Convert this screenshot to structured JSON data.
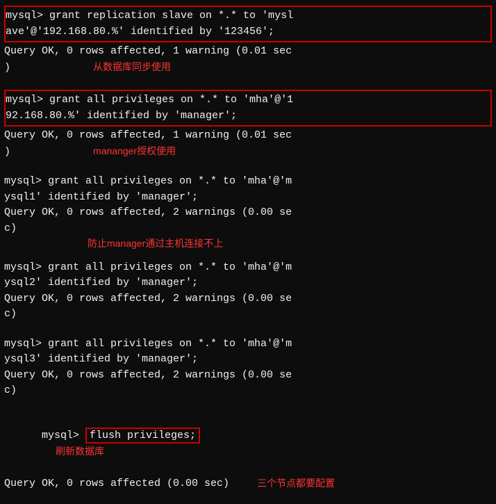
{
  "terminal": {
    "blocks": [
      {
        "id": "block1",
        "highlighted": true,
        "commands": [
          "mysql> grant replication slave on *.* to 'mysl",
          "ave'@'192.168.80.%' identified by '123456';"
        ],
        "results": [
          "Query OK, 0 rows affected, 1 warning (0.01 sec",
          ")"
        ],
        "annotation": "从数据库同步使用",
        "annotation_position": "inline"
      },
      {
        "id": "block2",
        "highlighted": true,
        "commands": [
          "mysql> grant all privileges on *.* to 'mha'@'1",
          "92.168.80.%' identified by 'manager';"
        ],
        "results": [
          "Query OK, 0 rows affected, 1 warning (0.01 sec",
          ")"
        ],
        "annotation": "mananger授权使用",
        "annotation_position": "inline"
      },
      {
        "id": "block3",
        "highlighted": false,
        "commands": [
          "mysql> grant all privileges on *.* to 'mha'@'m",
          "ysql1' identified by 'manager';"
        ],
        "results": [
          "Query OK, 0 rows affected, 2 warnings (0.00 se",
          "c)"
        ],
        "annotation": "防止manager通过主机连接不上",
        "annotation_position": "below"
      },
      {
        "id": "block4",
        "highlighted": false,
        "commands": [
          "mysql> grant all privileges on *.* to 'mha'@'m",
          "ysql2' identified by 'manager';"
        ],
        "results": [
          "Query OK, 0 rows affected, 2 warnings (0.00 se",
          "c)"
        ],
        "annotation": "",
        "annotation_position": ""
      },
      {
        "id": "block5",
        "highlighted": false,
        "commands": [
          "mysql> grant all privileges on *.* to 'mha'@'m",
          "ysql3' identified by 'manager';"
        ],
        "results": [
          "Query OK, 0 rows affected, 2 warnings (0.00 se",
          "c)"
        ],
        "annotation": "",
        "annotation_position": ""
      },
      {
        "id": "block6",
        "highlighted": false,
        "has_inline_highlight": true,
        "prompt": "mysql> ",
        "inline_cmd": "flush privileges;",
        "annotation1": "刷新数据库",
        "results": [
          "Query OK, 0 rows affected (0.00 sec)"
        ],
        "annotation2": "三个节点都要配置"
      }
    ]
  }
}
